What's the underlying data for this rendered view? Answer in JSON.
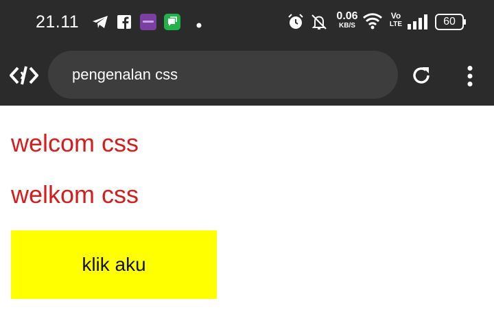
{
  "status_bar": {
    "time": "21.11",
    "net_speed_value": "0.06",
    "net_speed_unit": "KB/S",
    "volte_top": "Vo",
    "volte_bottom": "LTE",
    "battery": "60",
    "icons": [
      "telegram-icon",
      "facebook-icon",
      "app-icon",
      "messages-icon",
      "dot-icon",
      "alarm-icon",
      "silent-icon",
      "wifi-icon",
      "signal-icon",
      "battery-icon"
    ]
  },
  "browser": {
    "url": "pengenalan css",
    "icons": [
      "code-icon",
      "reload-icon",
      "menu-icon"
    ]
  },
  "page": {
    "heading1": "welcom css",
    "heading2": "welkom css",
    "button_label": "klik aku"
  },
  "colors": {
    "heading": "#d81b1b",
    "button_bg": "#ffff00",
    "toolbar_bg": "#2b2b2b",
    "urlbar_bg": "#3d3d3d"
  }
}
